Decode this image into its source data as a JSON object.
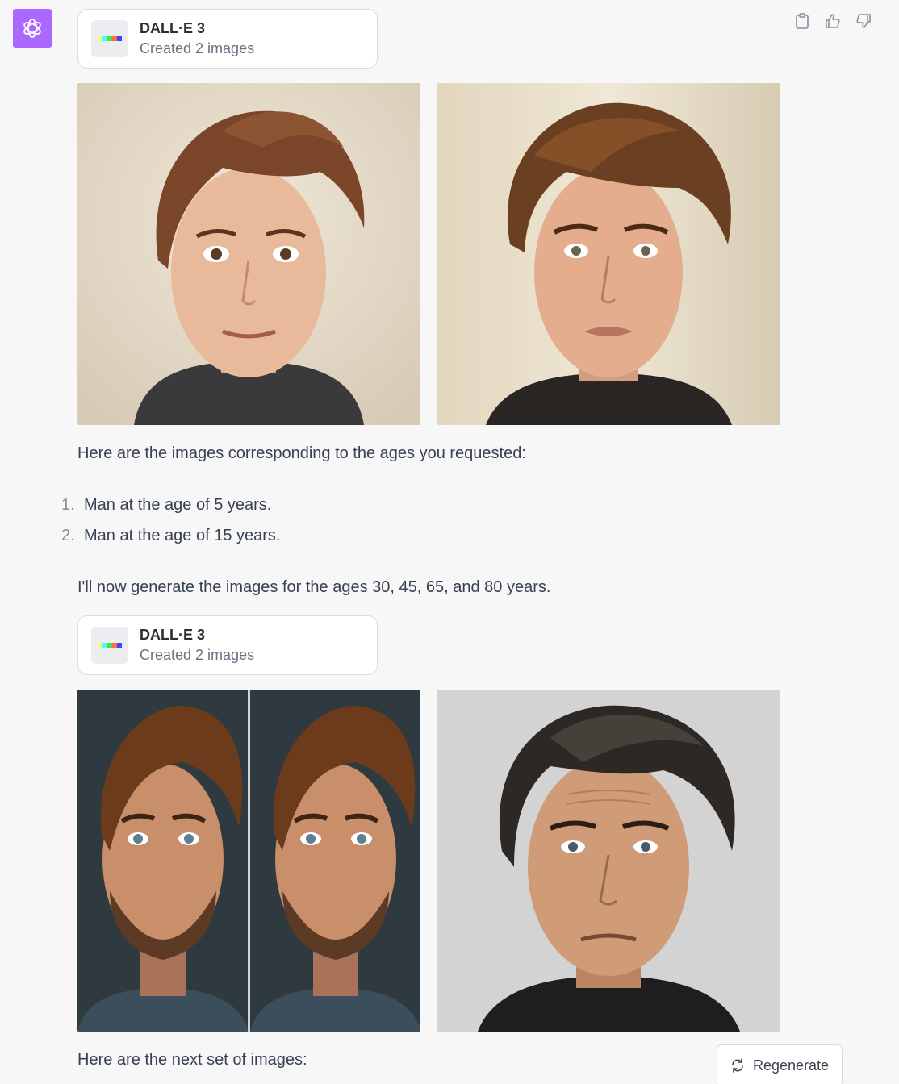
{
  "assistant": {
    "avatar_icon": "openai-logo-icon",
    "avatar_color": "#ab68ff"
  },
  "actions": [
    {
      "icon": "clipboard-icon"
    },
    {
      "icon": "thumbs-up-icon"
    },
    {
      "icon": "thumbs-down-icon"
    }
  ],
  "tool_cards": [
    {
      "name": "DALL·E 3",
      "status": "Created 2 images"
    },
    {
      "name": "DALL·E 3",
      "status": "Created 2 images"
    }
  ],
  "images": [
    {
      "label": "portrait young man light background"
    },
    {
      "label": "portrait teen man cream background"
    },
    {
      "label": "portrait diptych bearded man"
    },
    {
      "label": "portrait older man gray hair"
    }
  ],
  "message": {
    "intro": "Here are the images corresponding to the ages you requested:",
    "list": [
      {
        "num": "1.",
        "text": "Man at the age of 5 years."
      },
      {
        "num": "2.",
        "text": "Man at the age of 15 years."
      }
    ],
    "followup": "I'll now generate the images for the ages 30, 45, 65, and 80 years.",
    "closing": "Here are the next set of images:"
  },
  "regenerate": {
    "label": "Regenerate",
    "icon": "refresh-icon"
  }
}
